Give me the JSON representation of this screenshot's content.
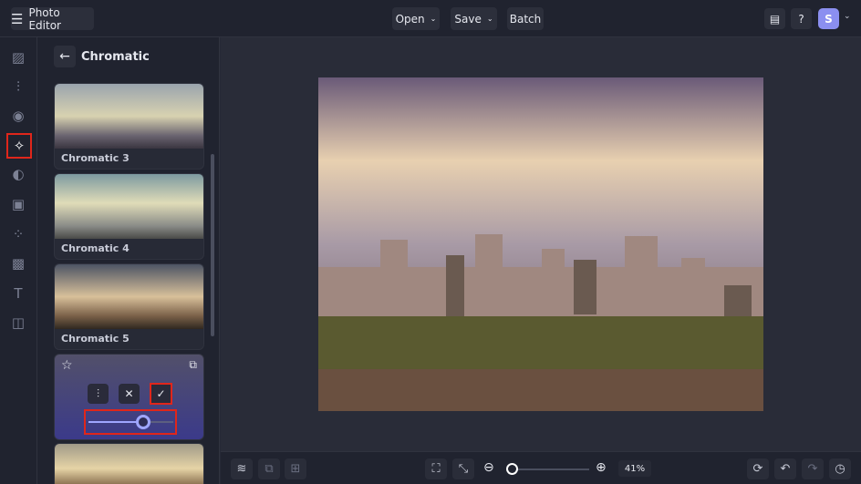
{
  "header": {
    "app_title": "Photo Editor",
    "open_label": "Open",
    "save_label": "Save",
    "batch_label": "Batch",
    "avatar_initial": "S"
  },
  "panel": {
    "title": "Chromatic",
    "presets": [
      {
        "label": "Chromatic 3"
      },
      {
        "label": "Chromatic 4"
      },
      {
        "label": "Chromatic 5"
      }
    ],
    "intensity": 0.65
  },
  "zoom": {
    "level": "41%",
    "slider": 0.05
  },
  "colors": {
    "accent": "#8b8ff0",
    "highlight": "#e0261b"
  }
}
